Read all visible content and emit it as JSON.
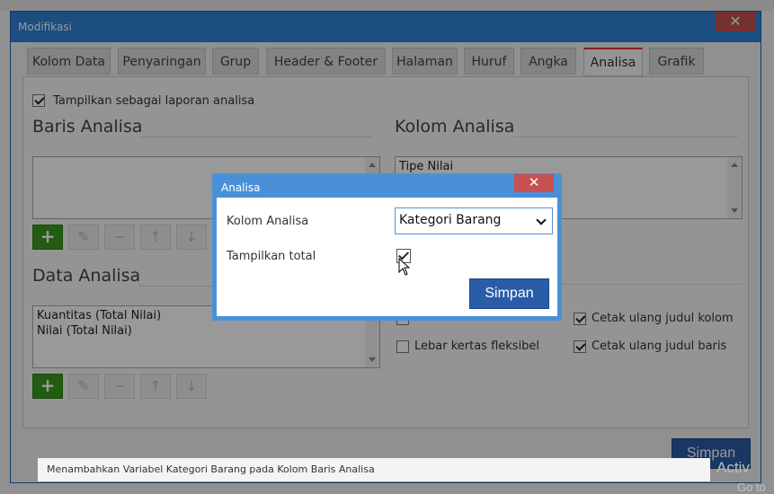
{
  "window": {
    "title": "Modifikasi",
    "close_glyph": "✕",
    "tabs": [
      {
        "label": "Kolom Data"
      },
      {
        "label": "Penyaringan"
      },
      {
        "label": "Grup"
      },
      {
        "label": "Header & Footer"
      },
      {
        "label": "Halaman"
      },
      {
        "label": "Huruf"
      },
      {
        "label": "Angka"
      },
      {
        "label": "Analisa",
        "active": true
      },
      {
        "label": "Grafik"
      }
    ],
    "show_as_analysis": {
      "label": "Tampilkan sebagai laporan analisa",
      "checked": true
    },
    "baris_analisa": {
      "title": "Baris Analisa",
      "items": []
    },
    "kolom_analisa": {
      "title": "Kolom Analisa",
      "items": [
        "Tipe Nilai"
      ]
    },
    "data_analisa": {
      "title": "Data Analisa",
      "items": [
        "Kuantitas (Total Nilai)",
        "Nilai (Total Nilai)"
      ]
    },
    "options": [
      {
        "label": "Cetak ulang judul kolom",
        "checked": true
      },
      {
        "label": "Lebar kertas fleksibel",
        "checked": false
      },
      {
        "label": "Cetak ulang judul baris",
        "checked": true
      }
    ],
    "save_label": "Simpan"
  },
  "dialog": {
    "title": "Analisa",
    "close_glyph": "✕",
    "kolom_label": "Kolom Analisa",
    "kolom_value": "Kategori Barang",
    "total_label": "Tampilkan total",
    "total_checked": true,
    "save_label": "Simpan"
  },
  "caption": "Menambahkan Variabel Kategori Barang pada Kolom Baris Analisa",
  "watermark": {
    "line1": "Activ",
    "line2": "Go to"
  }
}
